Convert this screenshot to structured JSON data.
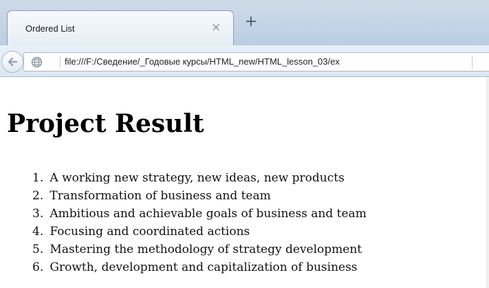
{
  "browser": {
    "tab": {
      "title": "Ordered List",
      "close_glyph": "×"
    },
    "new_tab_glyph": "+",
    "address_bar": {
      "url": "file:///F:/Сведение/_Годовые курсы/HTML_new/HTML_lesson_03/ex"
    }
  },
  "page": {
    "heading": "Project Result",
    "list": [
      {
        "number": "1.",
        "text": "A working new strategy, new ideas, new products"
      },
      {
        "number": "2.",
        "text": "Transformation of business and team"
      },
      {
        "number": "3.",
        "text": "Ambitious and achievable goals of business and team"
      },
      {
        "number": "4.",
        "text": "Focusing and coordinated actions"
      },
      {
        "number": "5.",
        "text": "Mastering the methodology of strategy development"
      },
      {
        "number": "6.",
        "text": "Growth, development and capitalization of business"
      }
    ]
  },
  "icons": {
    "back": "back-arrow-icon",
    "site": "globe-icon"
  },
  "colors": {
    "tabstrip": "#c8d6e7",
    "navbar": "#e4ecf5"
  }
}
